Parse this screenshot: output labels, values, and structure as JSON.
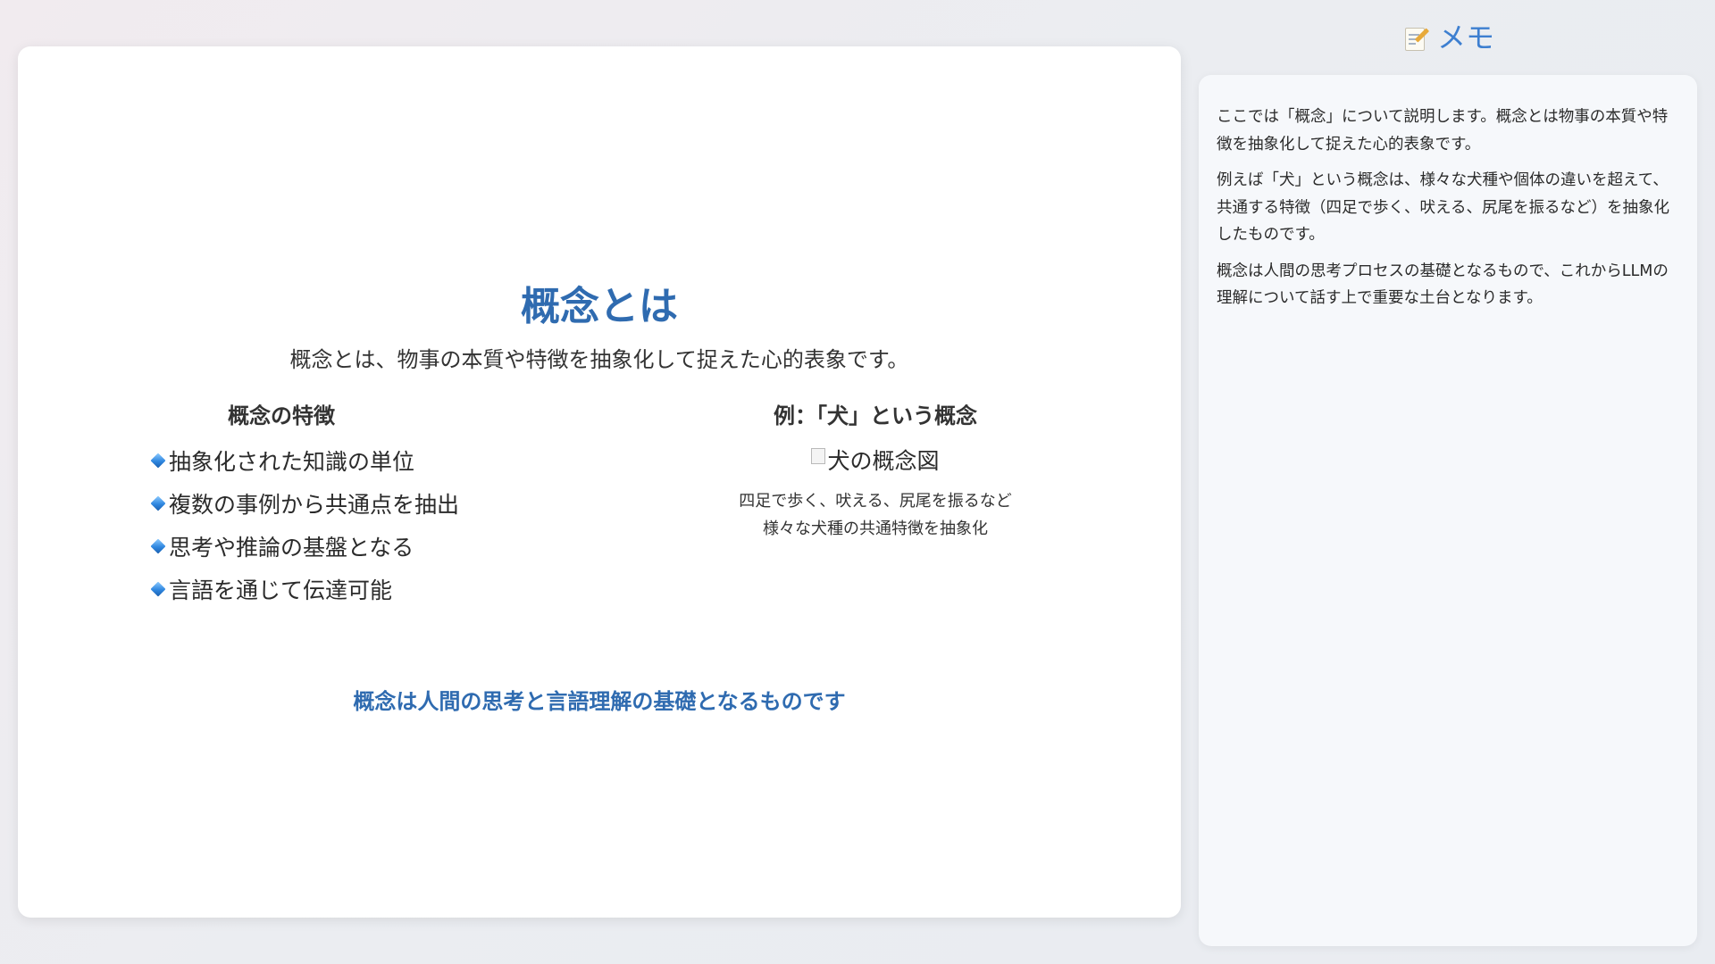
{
  "slide": {
    "title": "概念とは",
    "subtitle": "概念とは、物事の本質や特徴を抽象化して捉えた心的表象です。",
    "features": {
      "heading": "概念の特徴",
      "items": [
        {
          "label": "抽象化された知識の単位",
          "icon": "blue-diamond-icon"
        },
        {
          "label": "複数の事例から共通点を抽出",
          "icon": "blue-diamond-icon"
        },
        {
          "label": "思考や推論の基盤となる",
          "icon": "blue-diamond-icon"
        },
        {
          "label": "言語を通じて伝達可能",
          "icon": "blue-diamond-icon"
        }
      ]
    },
    "example": {
      "heading": "例：「犬」という概念",
      "image_alt": "犬の概念図",
      "caption_line1": "四足で歩く、吠える、尻尾を振るなど",
      "caption_line2": "様々な犬種の共通特徴を抽象化"
    },
    "conclusion": "概念は人間の思考と言語理解の基礎となるものです"
  },
  "memo": {
    "icon": "memo-pencil-icon",
    "title": "メモ",
    "paragraphs": [
      "ここでは「概念」について説明します。概念とは物事の本質や特徴を抽象化して捉えた心的表象です。",
      "例えば「犬」という概念は、様々な犬種や個体の違いを超えて、共通する特徴（四足で歩く、吠える、尻尾を振るなど）を抽象化したものです。",
      "概念は人間の思考プロセスの基礎となるもので、これからLLMの理解について話す上で重要な土台となります。"
    ]
  },
  "colors": {
    "accent": "#2f6bb0",
    "memo_title": "#3d7fd0",
    "text": "#2b2b2b"
  }
}
